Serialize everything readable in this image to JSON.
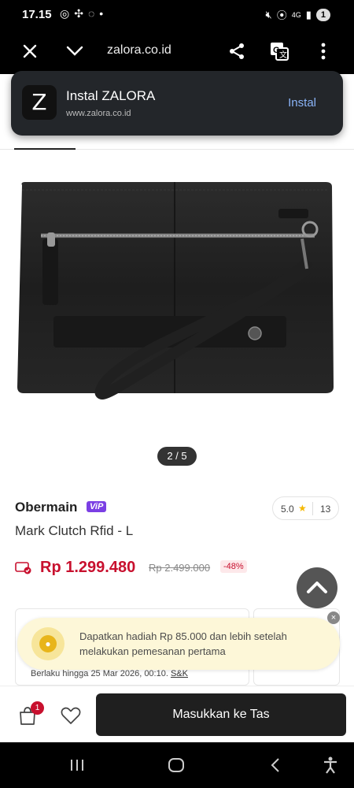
{
  "status_bar": {
    "time": "17.15",
    "left_icons": [
      "whatsapp-icon",
      "settings-fan-icon",
      "signal-messenger-icon",
      "dot-icon"
    ],
    "right_icons": [
      "mute-icon",
      "location-icon",
      "4g-data-icon",
      "signal-icon"
    ],
    "battery": "1"
  },
  "browser": {
    "url": "zalora.co.id"
  },
  "install_banner": {
    "logo_letter": "Z",
    "title": "Instal ZALORA",
    "site": "www.zalora.co.id",
    "button": "Instal"
  },
  "gallery": {
    "pager": "2 / 5"
  },
  "product": {
    "brand": "Obermain",
    "badge": "ViP",
    "rating": "5.0",
    "review_count": "13",
    "name": "Mark Clutch Rfid - L",
    "price": "Rp 1.299.480",
    "old_price": "Rp 2.499.000",
    "discount": "-48%"
  },
  "promo": {
    "toast_message": "Dapatkan hadiah Rp 85.000 dan lebih setelah melakukan pemesanan pertama",
    "validity": "Berlaku hingga 25 Mar 2026, 00:10.",
    "terms_link": "S&K"
  },
  "action_bar": {
    "cart_count": "1",
    "add_to_bag": "Masukkan ke Tas"
  },
  "colors": {
    "price_red": "#c8102e",
    "vip_purple": "#7b3fe4",
    "toast_bg": "#fdf7d8",
    "button_dark": "#1f1f1f"
  }
}
